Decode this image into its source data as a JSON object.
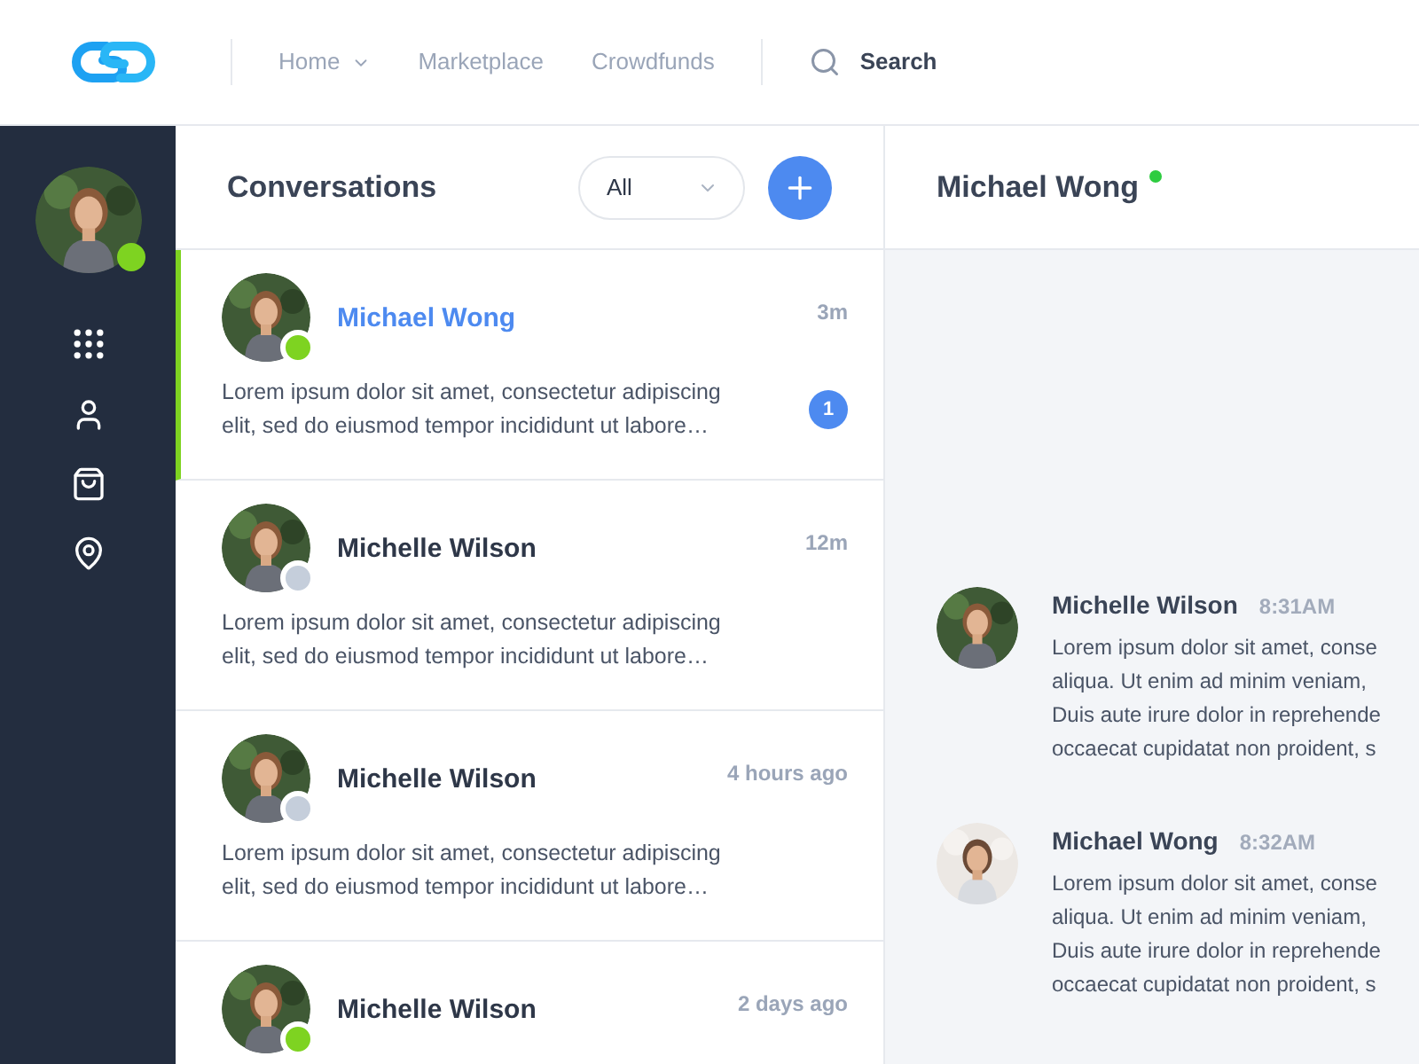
{
  "nav": {
    "items": [
      {
        "label": "Home",
        "dropdown": true
      },
      {
        "label": "Marketplace",
        "dropdown": false
      },
      {
        "label": "Crowdfunds",
        "dropdown": false
      }
    ]
  },
  "search": {
    "placeholder": "Search"
  },
  "profile": {
    "color": "#7ed321"
  },
  "conversations": {
    "title": "Conversations",
    "filter": "All",
    "items": [
      {
        "name": "Michael Wong",
        "time": "3m",
        "preview": "Lorem ipsum dolor sit amet, consectetur adipiscing elit, sed do eiusmod tempor incididunt ut labore…",
        "unread": "1",
        "selected": true,
        "color": "#7ed321"
      },
      {
        "name": "Michelle Wilson",
        "time": "12m",
        "preview": "Lorem ipsum dolor sit amet, consectetur adipiscing elit, sed do eiusmod tempor incididunt ut labore…",
        "selected": false,
        "color": "#c5cedb"
      },
      {
        "name": "Michelle Wilson",
        "time": "4 hours ago",
        "preview": "Lorem ipsum dolor sit amet, consectetur adipiscing elit, sed do eiusmod tempor incididunt ut labore…",
        "selected": false,
        "color": "#c5cedb"
      },
      {
        "name": "Michelle Wilson",
        "time": "2 days ago",
        "selected": false,
        "color": "#7ed321"
      }
    ]
  },
  "chat": {
    "contact": "Michael Wong",
    "color": "#2ecc40",
    "messages": [
      {
        "name": "Michelle Wilson",
        "time": "8:31AM",
        "lines": [
          "Lorem ipsum dolor sit amet, conse",
          "aliqua. Ut enim ad minim veniam,",
          "Duis aute irure dolor in reprehende",
          "occaecat cupidatat non proident, s"
        ]
      },
      {
        "name": "Michael Wong",
        "time": "8:32AM",
        "lines": [
          "Lorem ipsum dolor sit amet, conse",
          "aliqua. Ut enim ad minim veniam,",
          "Duis aute irure dolor in reprehende",
          "occaecat cupidatat non proident, s"
        ]
      }
    ]
  }
}
